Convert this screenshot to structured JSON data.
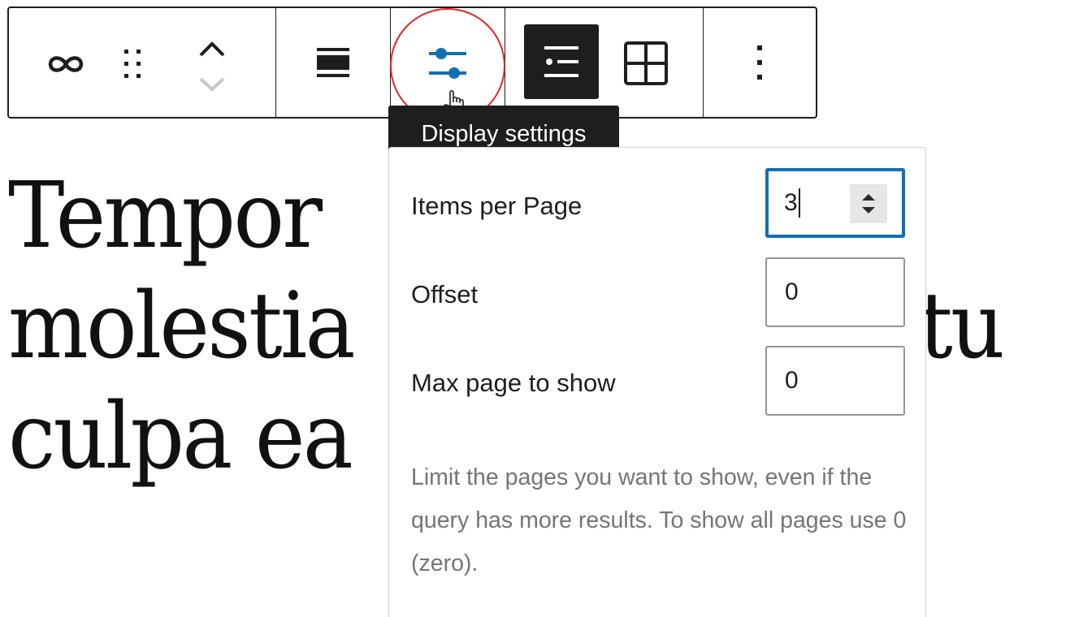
{
  "content": {
    "lines": [
      "Tempor",
      "molestia                     atu",
      "culpa ea"
    ]
  },
  "toolbar": {
    "buttons": [
      {
        "name": "block-type-icon",
        "label": "Block type"
      },
      {
        "name": "drag-handle-icon",
        "label": "Drag"
      },
      {
        "name": "move-up-icon",
        "label": "Move up"
      },
      {
        "name": "move-down-icon",
        "label": "Move down"
      },
      {
        "name": "align-icon",
        "label": "Align"
      },
      {
        "name": "sliders-icon",
        "label": "Display settings"
      },
      {
        "name": "list-view-icon",
        "label": "List view"
      },
      {
        "name": "grid-view-icon",
        "label": "Grid view"
      },
      {
        "name": "options-icon",
        "label": "Options"
      }
    ],
    "tooltip": "Display settings",
    "accent": "#1270b0"
  },
  "popover": {
    "fields": [
      {
        "label": "Items per Page",
        "value": "3",
        "focused": true
      },
      {
        "label": "Offset",
        "value": "0"
      },
      {
        "label": "Max page to show",
        "value": "0"
      }
    ],
    "help": "Limit the pages you want to show, even if the query has more results. To show all pages use 0 (zero)."
  }
}
